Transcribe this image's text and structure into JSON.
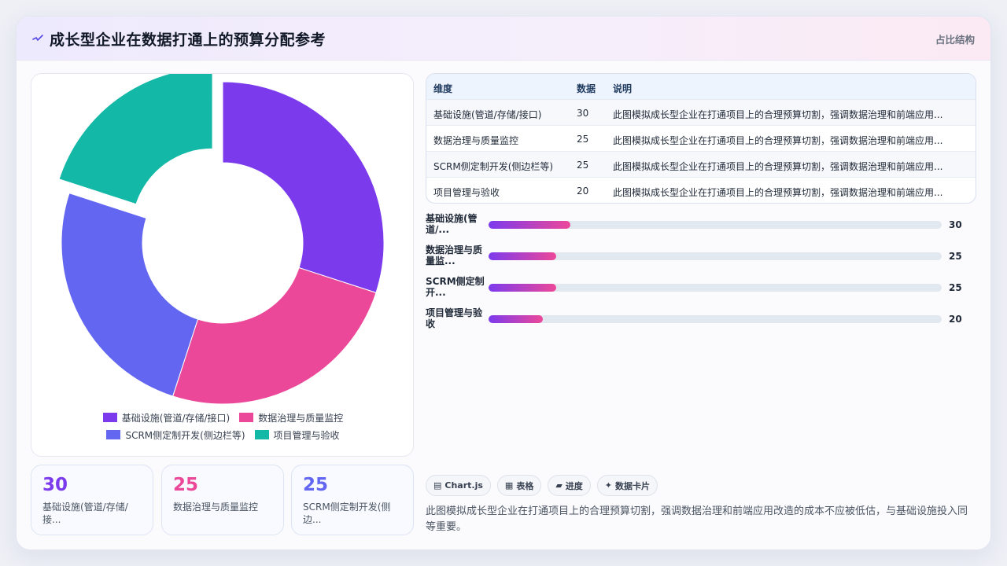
{
  "header": {
    "title": "成长型企业在数据打通上的预算分配参考",
    "tag": "占比结构"
  },
  "colors": {
    "purple": "#7c3aed",
    "pink": "#ec4899",
    "indigo": "#6366f1",
    "teal": "#14b8a6"
  },
  "chart_data": {
    "type": "pie",
    "variant": "doughnut",
    "categories": [
      "基础设施(管道/存储/接口)",
      "数据治理与质量监控",
      "SCRM侧定制开发(侧边栏等)",
      "项目管理与验收"
    ],
    "values": [
      30,
      25,
      25,
      20
    ],
    "colors": [
      "#7c3aed",
      "#ec4899",
      "#6366f1",
      "#14b8a6"
    ],
    "legend_position": "bottom"
  },
  "legend": {
    "row1": [
      "基础设施(管道/存储/接口)",
      "数据治理与质量监控"
    ],
    "row2": [
      "SCRM侧定制开发(侧边栏等)",
      "项目管理与验收"
    ]
  },
  "stats": [
    {
      "value": "30",
      "label": "基础设施(管道/存储/接...",
      "color": "#7c3aed"
    },
    {
      "value": "25",
      "label": "数据治理与质量监控",
      "color": "#ec4899"
    },
    {
      "value": "25",
      "label": "SCRM侧定制开发(侧边...",
      "color": "#6366f1"
    }
  ],
  "table": {
    "headers": [
      "维度",
      "数据",
      "说明"
    ],
    "rows": [
      [
        "基础设施(管道/存储/接口)",
        "30",
        "此图模拟成长型企业在打通项目上的合理预算切割，强调数据治理和前端应用..."
      ],
      [
        "数据治理与质量监控",
        "25",
        "此图模拟成长型企业在打通项目上的合理预算切割，强调数据治理和前端应用..."
      ],
      [
        "SCRM侧定制开发(侧边栏等)",
        "25",
        "此图模拟成长型企业在打通项目上的合理预算切割，强调数据治理和前端应用..."
      ],
      [
        "项目管理与验收",
        "20",
        "此图模拟成长型企业在打通项目上的合理预算切割，强调数据治理和前端应用..."
      ]
    ]
  },
  "bars": [
    {
      "label": "基础设施(管道/...",
      "value": 30,
      "display": "30"
    },
    {
      "label": "数据治理与质量监...",
      "value": 25,
      "display": "25"
    },
    {
      "label": "SCRM侧定制开...",
      "value": 25,
      "display": "25"
    },
    {
      "label": "项目管理与验收",
      "value": 20,
      "display": "20"
    }
  ],
  "chips": [
    "Chart.js",
    "表格",
    "进度",
    "数据卡片"
  ],
  "note": "此图模拟成长型企业在打通项目上的合理预算切割，强调数据治理和前端应用改造的成本不应被低估，与基础设施投入同等重要。"
}
